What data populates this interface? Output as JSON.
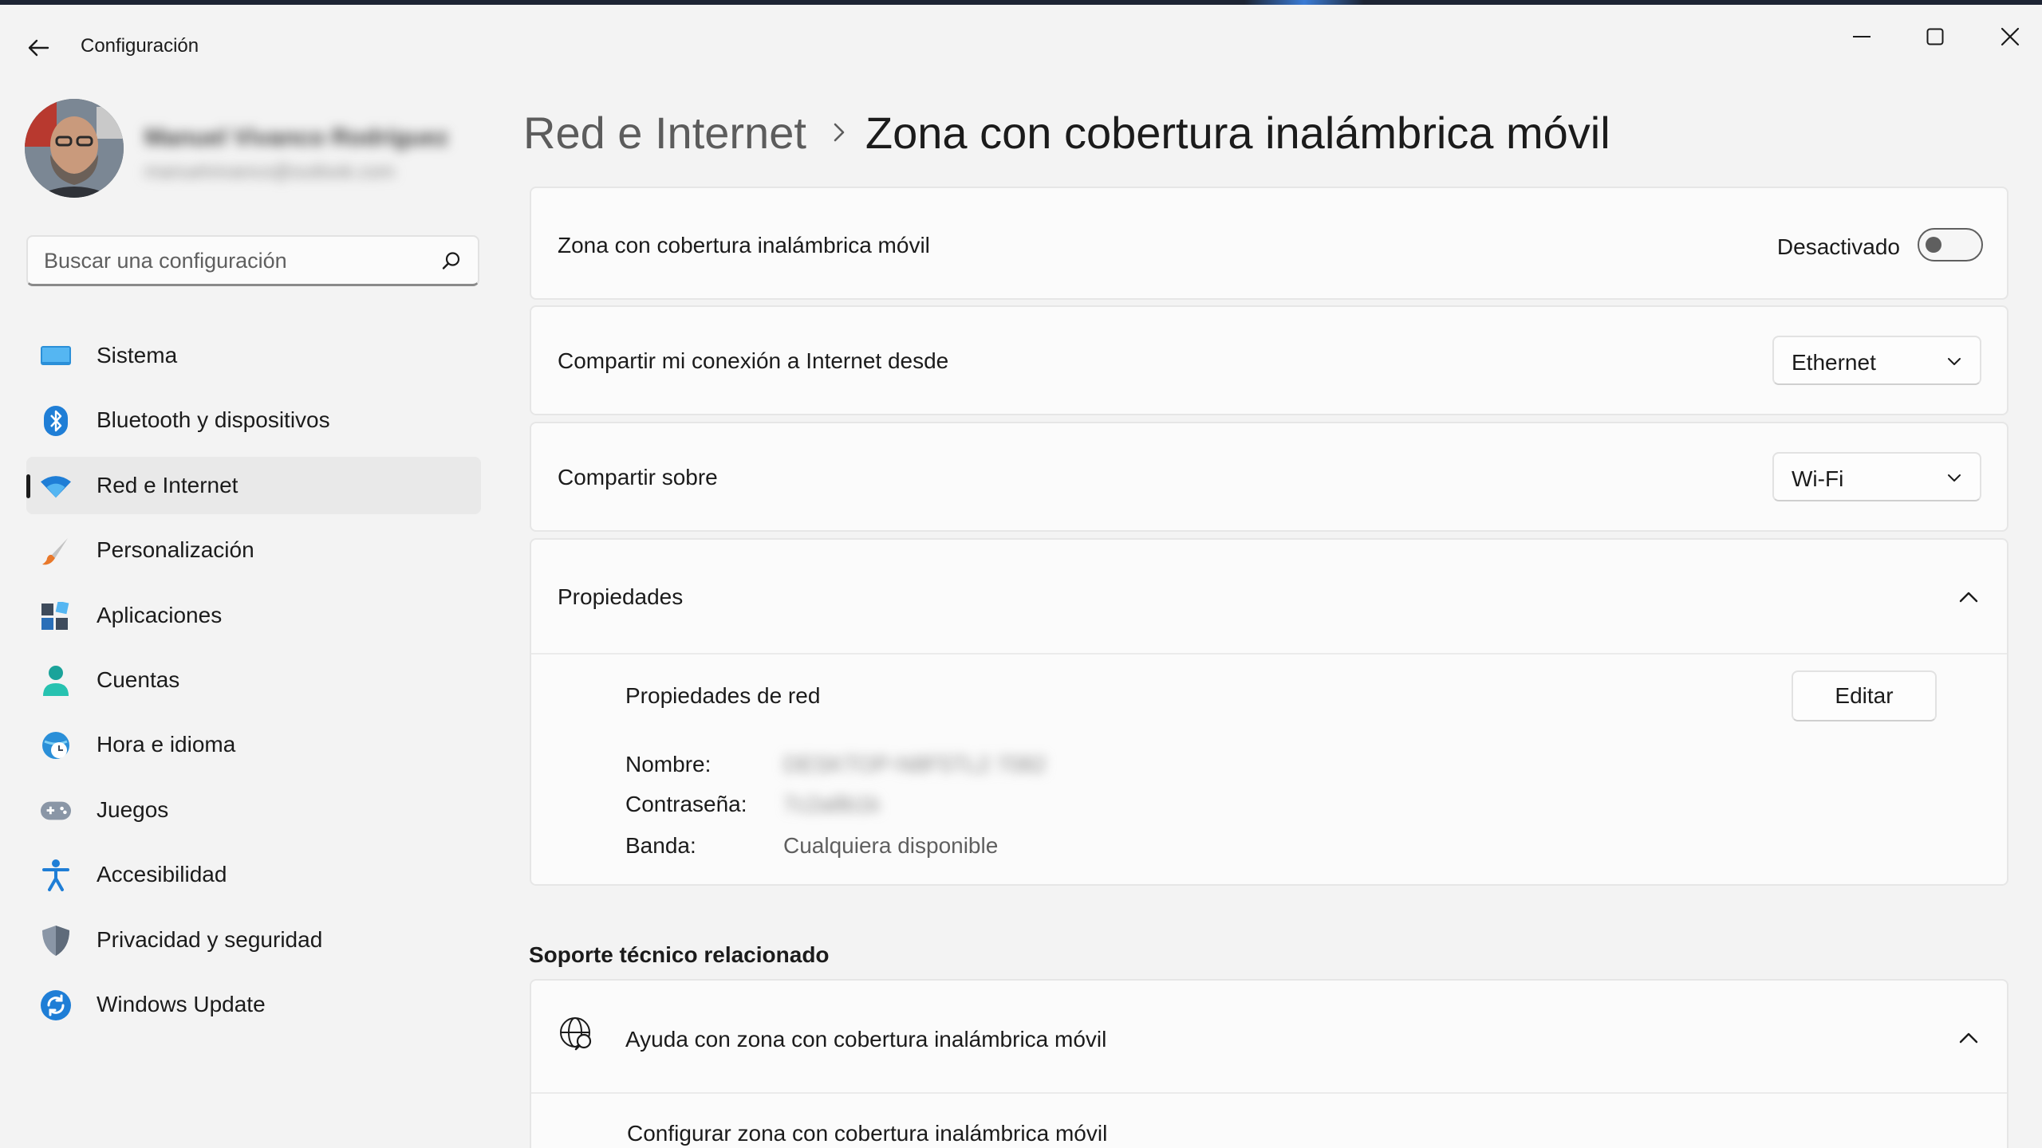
{
  "window": {
    "title": "Configuración"
  },
  "profile": {
    "name": "Manuel Vivanco Rodríguez",
    "email": "manuelvivanco@outlook.com"
  },
  "search": {
    "placeholder": "Buscar una configuración"
  },
  "sidebar": {
    "items": [
      {
        "label": "Sistema",
        "icon": "monitor-icon",
        "active": false
      },
      {
        "label": "Bluetooth y dispositivos",
        "icon": "bluetooth-icon",
        "active": false
      },
      {
        "label": "Red e Internet",
        "icon": "wifi-icon",
        "active": true
      },
      {
        "label": "Personalización",
        "icon": "brush-icon",
        "active": false
      },
      {
        "label": "Aplicaciones",
        "icon": "apps-icon",
        "active": false
      },
      {
        "label": "Cuentas",
        "icon": "person-icon",
        "active": false
      },
      {
        "label": "Hora e idioma",
        "icon": "globe-clock-icon",
        "active": false
      },
      {
        "label": "Juegos",
        "icon": "gamepad-icon",
        "active": false
      },
      {
        "label": "Accesibilidad",
        "icon": "accessibility-icon",
        "active": false
      },
      {
        "label": "Privacidad y seguridad",
        "icon": "shield-icon",
        "active": false
      },
      {
        "label": "Windows Update",
        "icon": "sync-icon",
        "active": false
      }
    ]
  },
  "breadcrumb": {
    "parent": "Red e Internet",
    "current": "Zona con cobertura inalámbrica móvil"
  },
  "hotspot": {
    "label": "Zona con cobertura inalámbrica móvil",
    "state_label": "Desactivado",
    "enabled": false
  },
  "share_from": {
    "label": "Compartir mi conexión a Internet desde",
    "value": "Ethernet"
  },
  "share_over": {
    "label": "Compartir sobre",
    "value": "Wi-Fi"
  },
  "properties": {
    "header": "Propiedades",
    "subtitle": "Propiedades de red",
    "edit_label": "Editar",
    "name_key": "Nombre:",
    "name_value": "DESKTOP-N8F5TL2 7082",
    "password_key": "Contraseña:",
    "password_value": "7c2a8b1k",
    "band_key": "Banda:",
    "band_value": "Cualquiera disponible"
  },
  "support": {
    "section_title": "Soporte técnico relacionado",
    "help_label": "Ayuda con zona con cobertura inalámbrica móvil",
    "link_label": "Configurar zona con cobertura inalámbrica móvil"
  },
  "colors": {
    "accent": "#0067c0",
    "background": "#f3f3f3",
    "card": "#fbfbfb"
  }
}
